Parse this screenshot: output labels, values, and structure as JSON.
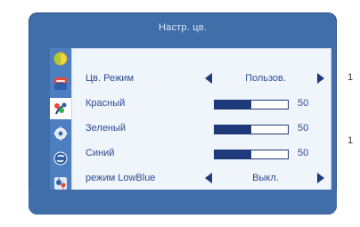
{
  "page": {
    "side_labels": [
      "1",
      "1"
    ]
  },
  "osd": {
    "title": "Настр. цв.",
    "colors": {
      "frame": "#3f6ea8",
      "panel": "#f0f4fb",
      "text": "#2b4c8f",
      "bar": "#1f3a7a"
    },
    "sidebar": {
      "items": [
        {
          "icon": "brightness-icon",
          "active": false
        },
        {
          "icon": "image-icon",
          "active": false
        },
        {
          "icon": "color-icon",
          "active": true
        },
        {
          "icon": "osd-settings-icon",
          "active": false
        },
        {
          "icon": "reset-icon",
          "active": false
        },
        {
          "icon": "extra-settings-icon",
          "active": false
        }
      ]
    },
    "rows": [
      {
        "label": "Цв. Режим",
        "type": "select",
        "value": "Пользов."
      },
      {
        "label": "Красный",
        "type": "slider",
        "value": 50,
        "max": 100
      },
      {
        "label": "Зеленый",
        "type": "slider",
        "value": 50,
        "max": 100
      },
      {
        "label": "Синий",
        "type": "slider",
        "value": 50,
        "max": 100
      },
      {
        "label": "режим LowBlue",
        "type": "select",
        "value": "Выкл."
      }
    ]
  }
}
